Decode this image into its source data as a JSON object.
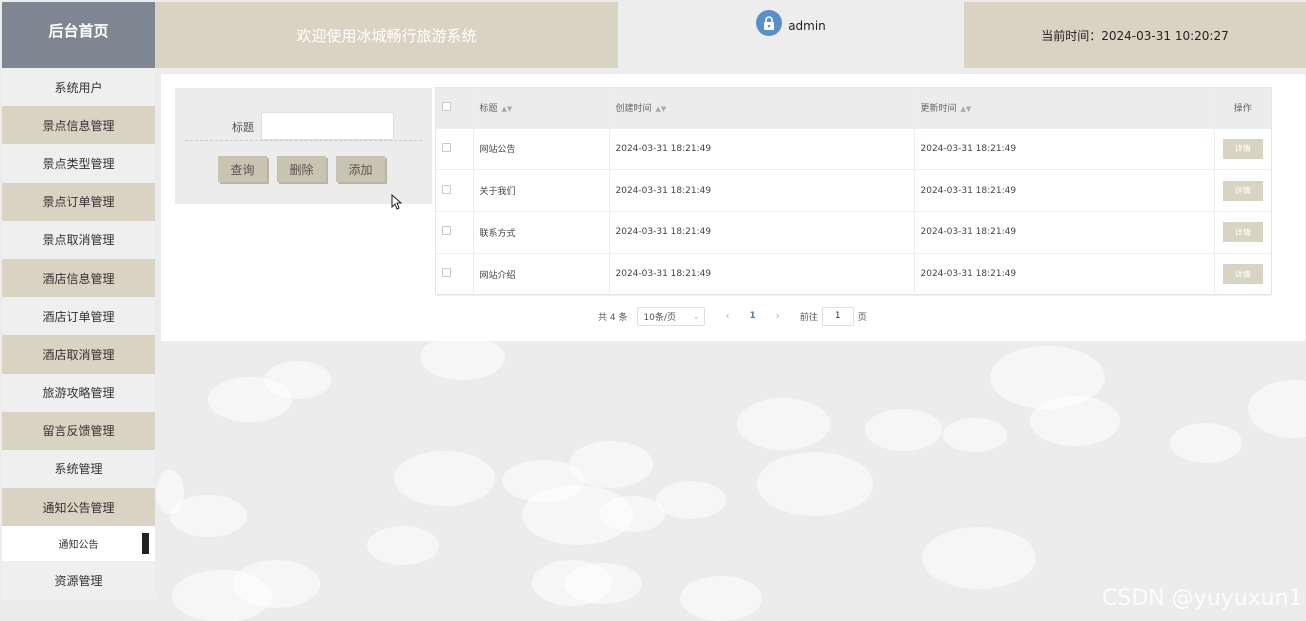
{
  "header": {
    "brand": "后台首页",
    "welcome": "欢迎使用冰城畅行旅游系统",
    "username": "admin",
    "time_label": "当前时间：2024-03-31 10:20:27"
  },
  "sidebar": {
    "items": [
      "系统用户",
      "景点信息管理",
      "景点类型管理",
      "景点订单管理",
      "景点取消管理",
      "酒店信息管理",
      "酒店订单管理",
      "酒店取消管理",
      "旅游攻略管理",
      "留言反馈管理",
      "系统管理",
      "通知公告管理"
    ],
    "submenu_active": "通知公告",
    "last_item": "资源管理"
  },
  "search": {
    "label": "标题",
    "value": "",
    "buttons": {
      "query": "查询",
      "delete": "删除",
      "add": "添加"
    }
  },
  "table": {
    "columns": {
      "title": "标题",
      "created": "创建时间",
      "updated": "更新时间",
      "action": "操作"
    },
    "rows": [
      {
        "title": "网站公告",
        "created": "2024-03-31 18:21:49",
        "updated": "2024-03-31 18:21:49"
      },
      {
        "title": "关于我们",
        "created": "2024-03-31 18:21:49",
        "updated": "2024-03-31 18:21:49"
      },
      {
        "title": "联系方式",
        "created": "2024-03-31 18:21:49",
        "updated": "2024-03-31 18:21:49"
      },
      {
        "title": "网站介绍",
        "created": "2024-03-31 18:21:49",
        "updated": "2024-03-31 18:21:49"
      }
    ],
    "detail_label": "详情"
  },
  "pagination": {
    "total": "共 4 条",
    "page_size": "10条/页",
    "current_page": "1",
    "goto_prefix": "前往",
    "goto_value": "1",
    "goto_suffix": "页"
  },
  "watermark": "CSDN @yuyuxun1",
  "colors": {
    "accent": "#d8d3c2",
    "brand": "#7e8791",
    "active_page": "#4a7fc0"
  },
  "icons": {
    "avatar": "lock-avatar-icon",
    "sort": "sort-caret-icon",
    "prev": "chevron-left-icon",
    "next": "chevron-right-icon",
    "dropdown": "chevron-down-icon"
  }
}
